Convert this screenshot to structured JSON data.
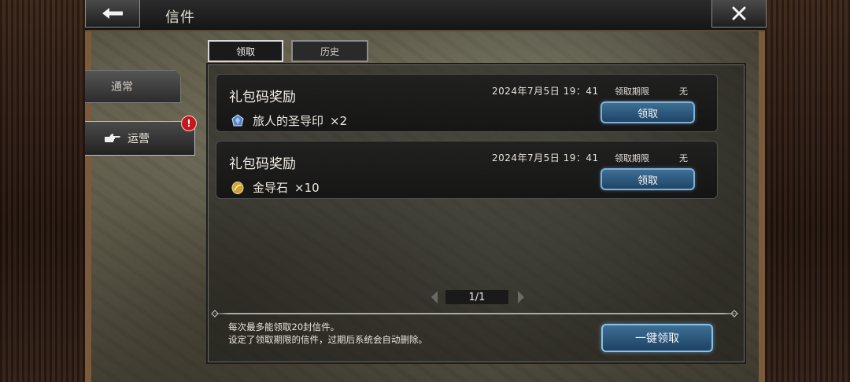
{
  "header": {
    "title": "信件",
    "back_icon": "arrow-left-icon",
    "close_icon": "close-icon"
  },
  "sidebar": {
    "items": [
      {
        "label": "通常",
        "icon": ""
      },
      {
        "label": "运营",
        "icon": "pointing-hand-icon",
        "badge": "!"
      }
    ]
  },
  "tabs": [
    {
      "label": "领取",
      "selected": true
    },
    {
      "label": "历史",
      "selected": false
    }
  ],
  "mails": [
    {
      "title": "礼包码奖励",
      "date": "2024年7月5日 19：41",
      "deadline_label": "领取期限",
      "deadline_value": "无",
      "item_name": "旅人的圣导印",
      "item_qty": "×2",
      "item_icon": "blue-crystal-icon",
      "claim_label": "领取"
    },
    {
      "title": "礼包码奖励",
      "date": "2024年7月5日 19：41",
      "deadline_label": "领取期限",
      "deadline_value": "无",
      "item_name": "金导石",
      "item_qty": "×10",
      "item_icon": "gold-stone-icon",
      "claim_label": "领取"
    }
  ],
  "pager": {
    "label": "1/1"
  },
  "notes": [
    "每次最多能领取20封信件。",
    "设定了领取期限的信件，过期后系统会自动删除。"
  ],
  "claim_all_label": "一键领取",
  "colors": {
    "button_blue": "#2e5a80",
    "button_border": "#7fb0d4",
    "badge_red": "#c8171a"
  }
}
